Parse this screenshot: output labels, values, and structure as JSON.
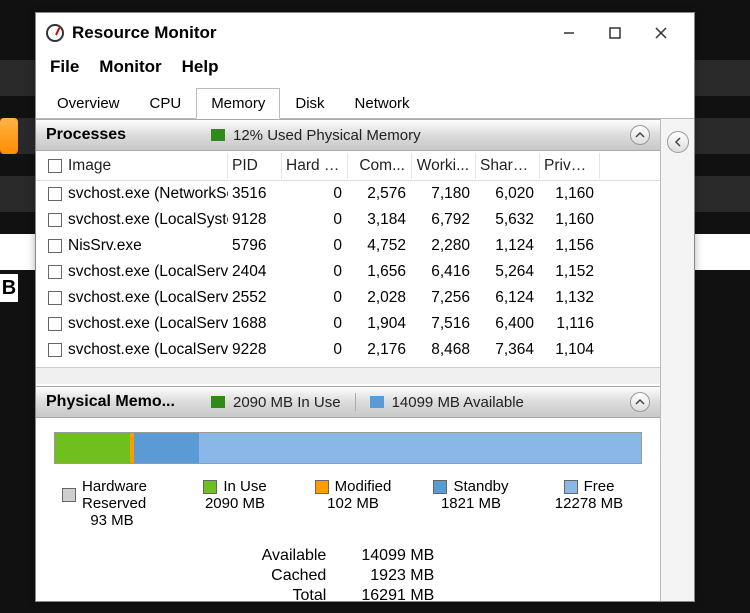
{
  "window": {
    "title": "Resource Monitor"
  },
  "menu": {
    "file": "File",
    "monitor": "Monitor",
    "help": "Help"
  },
  "tabs": {
    "overview": "Overview",
    "cpu": "CPU",
    "memory": "Memory",
    "disk": "Disk",
    "network": "Network"
  },
  "processes": {
    "title": "Processes",
    "status": "12% Used Physical Memory",
    "columns": {
      "image": "Image",
      "pid": "PID",
      "hf": "Hard F...",
      "commit": "Com...",
      "working": "Worki...",
      "share": "Share...",
      "private": "Privat..."
    },
    "rows": [
      {
        "image": "svchost.exe (NetworkSer...",
        "pid": "3516",
        "hf": "0",
        "commit": "2,576",
        "working": "7,180",
        "share": "6,020",
        "private": "1,160"
      },
      {
        "image": "svchost.exe (LocalSyste...",
        "pid": "9128",
        "hf": "0",
        "commit": "3,184",
        "working": "6,792",
        "share": "5,632",
        "private": "1,160"
      },
      {
        "image": "NisSrv.exe",
        "pid": "5796",
        "hf": "0",
        "commit": "4,752",
        "working": "2,280",
        "share": "1,124",
        "private": "1,156"
      },
      {
        "image": "svchost.exe (LocalServic...",
        "pid": "2404",
        "hf": "0",
        "commit": "1,656",
        "working": "6,416",
        "share": "5,264",
        "private": "1,152"
      },
      {
        "image": "svchost.exe (LocalServic...",
        "pid": "2552",
        "hf": "0",
        "commit": "2,028",
        "working": "7,256",
        "share": "6,124",
        "private": "1,132"
      },
      {
        "image": "svchost.exe (LocalServic...",
        "pid": "1688",
        "hf": "0",
        "commit": "1,904",
        "working": "7,516",
        "share": "6,400",
        "private": "1,116"
      },
      {
        "image": "svchost.exe (LocalServic...",
        "pid": "9228",
        "hf": "0",
        "commit": "2,176",
        "working": "8,468",
        "share": "7,364",
        "private": "1,104"
      }
    ]
  },
  "physical": {
    "title": "Physical Memo...",
    "in_use_label": "2090 MB In Use",
    "available_label": "14099 MB Available",
    "legend": {
      "hardware": {
        "label": "Hardware Reserved",
        "value": "93 MB"
      },
      "inuse": {
        "label": "In Use",
        "value": "2090 MB"
      },
      "modified": {
        "label": "Modified",
        "value": "102 MB"
      },
      "standby": {
        "label": "Standby",
        "value": "1821 MB"
      },
      "free": {
        "label": "Free",
        "value": "12278 MB"
      }
    },
    "summary": {
      "available_k": "Available",
      "available_v": "14099 MB",
      "cached_k": "Cached",
      "cached_v": "1923 MB",
      "total_k": "Total",
      "total_v": "16291 MB"
    }
  },
  "chart_data": {
    "type": "bar",
    "title": "Physical Memory Usage",
    "unit": "MB",
    "total": 16291,
    "series": [
      {
        "name": "Hardware Reserved",
        "value": 93,
        "color": "#cfcfcf"
      },
      {
        "name": "In Use",
        "value": 2090,
        "color": "#6fbf1f"
      },
      {
        "name": "Modified",
        "value": 102,
        "color": "#ff9d00"
      },
      {
        "name": "Standby",
        "value": 1821,
        "color": "#5b9bd5"
      },
      {
        "name": "Free",
        "value": 12278,
        "color": "#8ab8e6"
      }
    ],
    "available": 14099,
    "cached": 1923
  }
}
